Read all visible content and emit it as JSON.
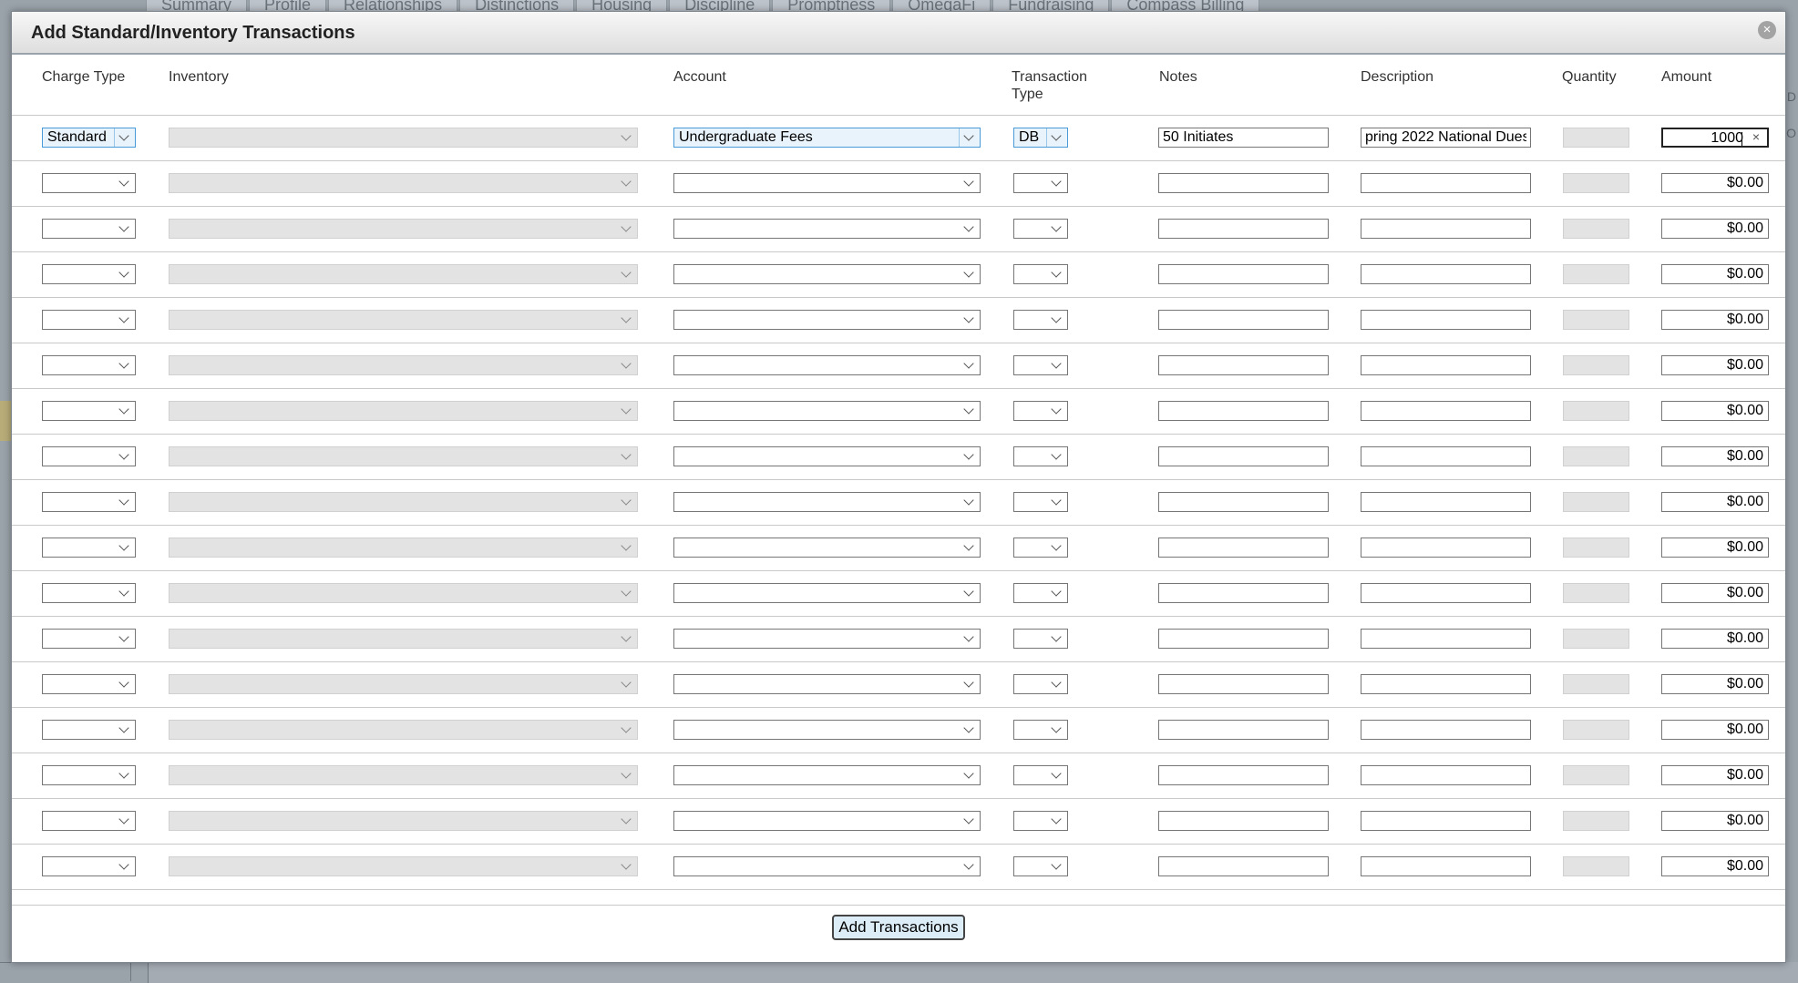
{
  "background": {
    "tabs": [
      "Summary",
      "Profile",
      "Relationships",
      "Distinctions",
      "Housing",
      "Discipline",
      "Promptness",
      "OmegaFi",
      "Fundraising",
      "Compass Billing"
    ]
  },
  "dialog": {
    "title": "Add Standard/Inventory Transactions",
    "close_icon": "close-icon"
  },
  "columns": {
    "charge_type": "Charge Type",
    "inventory": "Inventory",
    "account": "Account",
    "transaction_type_line1": "Transaction",
    "transaction_type_line2": "Type",
    "notes": "Notes",
    "description": "Description",
    "quantity": "Quantity",
    "amount": "Amount"
  },
  "first_row": {
    "charge_type": "Standard",
    "inventory": "",
    "account": "Undergraduate Fees",
    "transaction_type": "DB",
    "notes": "50 Initiates",
    "description": "pring 2022 National Dues",
    "quantity": "",
    "amount": "1000",
    "clear_icon": "×"
  },
  "empty_row_count": 16,
  "empty_amount": "$0.00",
  "footer": {
    "add_button": "Add Transactions"
  }
}
